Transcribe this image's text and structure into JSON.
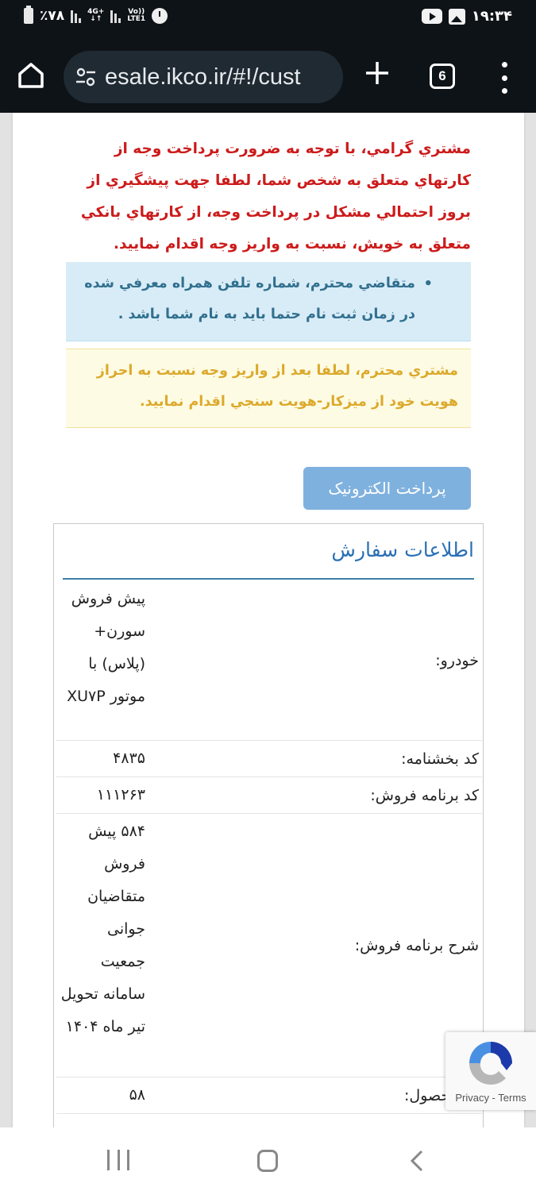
{
  "status_bar": {
    "battery": "٪۷۸",
    "network_1": "4G+",
    "network_2_top": "Vo))",
    "network_2_bottom": "LTE1",
    "time": "۱۹:۳۴"
  },
  "browser": {
    "url": "esale.ikco.ir/#!/cust",
    "tab_count": "6"
  },
  "page": {
    "warning_red": "مشتري گرامي، با توجه به ضرورت پرداخت وجه از کارتهاي متعلق به شخص شما، لطفا جهت پيشگيري از بروز احتمالي مشکل در پرداخت وجه، از کارتهاي بانکي متعلق به خويش، نسبت به واريز وجه اقدام نماييد.",
    "info_items": [
      "متقاضي محترم، شماره تلفن همراه معرفي شده در زمان ثبت نام حتما بايد به نام شما باشد ."
    ],
    "warning_yellow": "مشتري محترم، لطفا بعد از واريز وجه نسبت به احراز هويت خود از ميزکار-هويت سنجي اقدام نماييد.",
    "pay_button": "پرداخت الکترونیک",
    "order_panel": {
      "title": "اطلاعات سفارش",
      "rows": [
        {
          "label": "خودرو:",
          "value": "پیش فروش سورن+ (پلاس) با موتور XU۷P"
        },
        {
          "label": "کد بخشنامه:",
          "value": "۴۸۳۵"
        },
        {
          "label": "کد برنامه فروش:",
          "value": "۱۱۱۲۶۳"
        },
        {
          "label": "شرح برنامه فروش:",
          "value": "۵۸۴ پیش فروش متقاضیان جوانی جمعیت سامانه تحویل تیر ماه ۱۴۰۴"
        },
        {
          "label": "کد محصول:",
          "value": "۵۸"
        }
      ]
    }
  },
  "recaptcha": {
    "links": "Privacy - Terms"
  },
  "colors": {
    "warning_red": "#cc1b1b",
    "info_text": "#31708f",
    "info_bg": "#d8ecf7",
    "warn_text": "#dca92c",
    "warn_bg": "#fdfbe3",
    "button_bg": "#7fb1de",
    "panel_title": "#2a6fb5"
  }
}
